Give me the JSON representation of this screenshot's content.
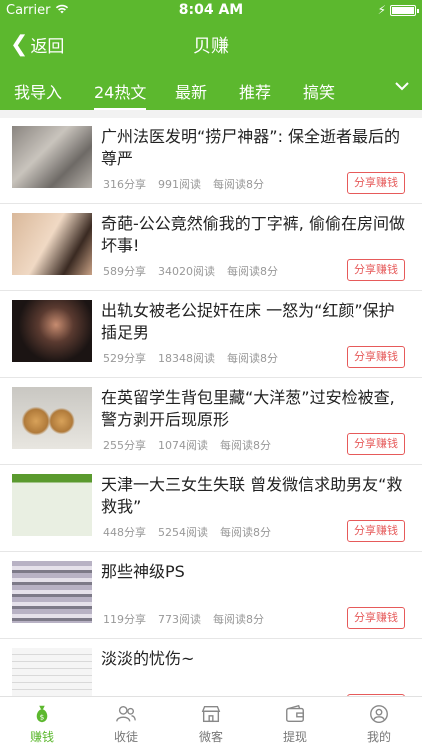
{
  "statusbar": {
    "carrier": "Carrier",
    "time": "8:04 AM"
  },
  "navbar": {
    "back_label": "返回",
    "title": "贝赚"
  },
  "tabs": [
    "我导入",
    "24热文",
    "最新",
    "推荐",
    "搞笑"
  ],
  "active_tab": "24热文",
  "share_label": "分享赚钱",
  "articles": [
    {
      "title": "广州法医发明“捞尸神器”: 保全逝者最后的尊严",
      "shares": "316分享",
      "reads": "991阅读",
      "rate": "每阅读8分"
    },
    {
      "title": "奇葩-公公竟然偷我的丁字裤, 偷偷在房间做坏事!",
      "shares": "589分享",
      "reads": "34020阅读",
      "rate": "每阅读8分"
    },
    {
      "title": "出轨女被老公捉奸在床 一怒为“红颜”保护插足男",
      "shares": "529分享",
      "reads": "18348阅读",
      "rate": "每阅读8分"
    },
    {
      "title": "在英留学生背包里藏“大洋葱”过安检被查, 警方剥开后现原形",
      "shares": "255分享",
      "reads": "1074阅读",
      "rate": "每阅读8分"
    },
    {
      "title": "天津一大三女生失联 曾发微信求助男友“救救我”",
      "shares": "448分享",
      "reads": "5254阅读",
      "rate": "每阅读8分"
    },
    {
      "title": "那些神级PS",
      "shares": "119分享",
      "reads": "773阅读",
      "rate": "每阅读8分"
    },
    {
      "title": "淡淡的忧伤~",
      "shares": "",
      "reads": "",
      "rate": ""
    }
  ],
  "tabbar": [
    "赚钱",
    "收徒",
    "微客",
    "提现",
    "我的"
  ],
  "colors": {
    "brand": "#5cb82e",
    "share_red": "#e65a5a",
    "meta_gray": "#999999"
  }
}
